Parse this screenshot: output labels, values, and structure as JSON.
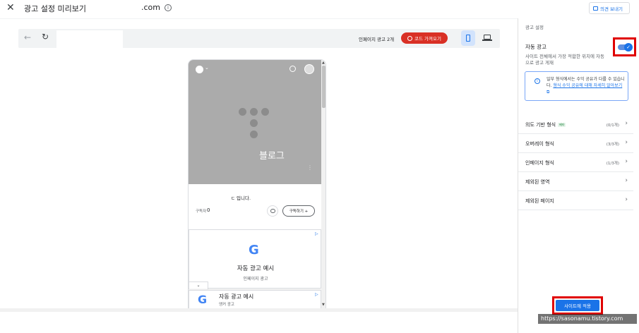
{
  "header": {
    "close_icon": "close-icon",
    "title": "광고 설정 미리보기",
    "domain": ".com",
    "feedback_label": "의견 보내기"
  },
  "toolbar": {
    "ad_count": "인페이지 광고 2개",
    "code_button": "코드 가져오기",
    "code_color": "#d93025"
  },
  "preview": {
    "blog_title": "블로그",
    "description": "ㄷ 입니다.",
    "subscribers_label": "구독자",
    "subscribers_count": "0",
    "subscribe_button": "구독하기 +",
    "ad1_title": "자동 광고 예시",
    "ad1_sub": "인페이지 광고",
    "ad2_title": "자동 광고 예시",
    "ad2_sub": "앵커 광고",
    "collapse_icon": "chevron-down-icon"
  },
  "panel": {
    "title": "광고 설정",
    "auto_ads_label": "자동 광고",
    "auto_ads_enabled": true,
    "auto_ads_desc": "사이트 전체에서 가장 적합한 위치에 자동으로 광고 게재",
    "info_text": "일부 형식에서는 수익 공유가 다를 수 있습니다.",
    "info_link": "형식 수익 공유에 대해 자세히 알아보기",
    "sections": [
      {
        "label": "의도 기반 형식",
        "badge": "베타",
        "count": "(0/1개)"
      },
      {
        "label": "오버레이 형식",
        "count": "(3/3개)"
      },
      {
        "label": "인페이지 형식",
        "count": "(1/3개)"
      },
      {
        "label": "제외된 영역",
        "count": ""
      },
      {
        "label": "제외된 페이지",
        "count": ""
      }
    ],
    "apply_button": "사이트에 적용",
    "accent": "#1a73e8",
    "highlight": "#e00000"
  },
  "watermark": "https://sasonamu.tistory.com"
}
